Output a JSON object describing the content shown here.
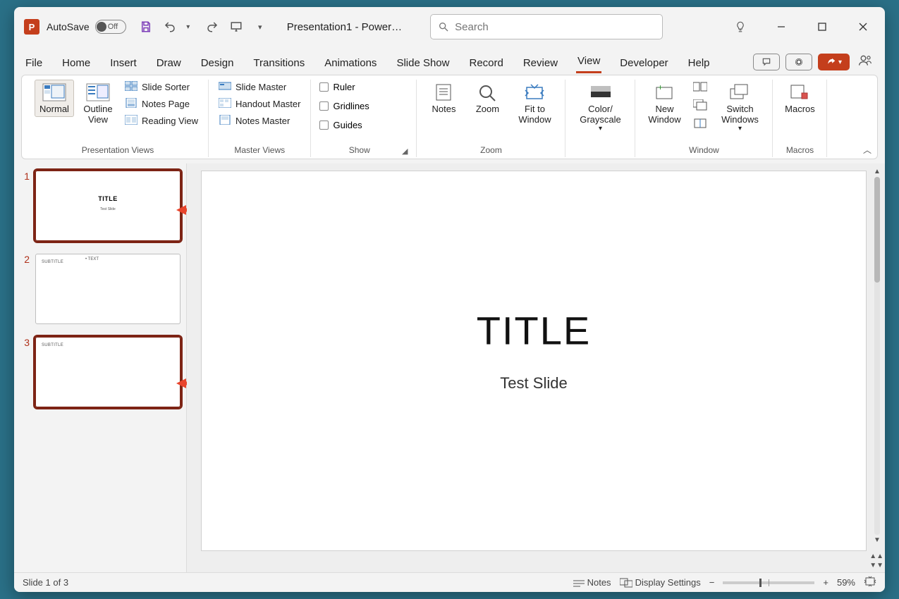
{
  "app": {
    "letter": "P",
    "autosave_label": "AutoSave",
    "autosave_state": "Off",
    "filename": "Presentation1  -  Power…"
  },
  "search": {
    "placeholder": "Search"
  },
  "tabs": [
    "File",
    "Home",
    "Insert",
    "Draw",
    "Design",
    "Transitions",
    "Animations",
    "Slide Show",
    "Record",
    "Review",
    "View",
    "Developer",
    "Help"
  ],
  "active_tab": "View",
  "ribbon": {
    "presentation_views": {
      "label": "Presentation Views",
      "normal": "Normal",
      "outline": "Outline View",
      "slide_sorter": "Slide Sorter",
      "notes_page": "Notes Page",
      "reading_view": "Reading View"
    },
    "master_views": {
      "label": "Master Views",
      "slide_master": "Slide Master",
      "handout_master": "Handout Master",
      "notes_master": "Notes Master"
    },
    "show": {
      "label": "Show",
      "ruler": "Ruler",
      "gridlines": "Gridlines",
      "guides": "Guides"
    },
    "zoom": {
      "label": "Zoom",
      "notes": "Notes",
      "zoom": "Zoom",
      "fit": "Fit to Window"
    },
    "color": {
      "label": "",
      "btn": "Color/ Grayscale"
    },
    "window": {
      "label": "Window",
      "new": "New Window",
      "switch": "Switch Windows"
    },
    "macros": {
      "label": "Macros",
      "btn": "Macros"
    }
  },
  "slides": {
    "items": [
      {
        "num": "1",
        "title": "TITLE",
        "sub": "Test Slide"
      },
      {
        "num": "2",
        "subtitle": "SUBTITLE",
        "text": "• TEXT"
      },
      {
        "num": "3",
        "subtitle": "SUBTITLE"
      }
    ]
  },
  "canvas": {
    "title": "TITLE",
    "subtitle": "Test Slide"
  },
  "status": {
    "slide": "Slide 1 of 3",
    "notes": "Notes",
    "display": "Display Settings",
    "zoom": "59%"
  }
}
